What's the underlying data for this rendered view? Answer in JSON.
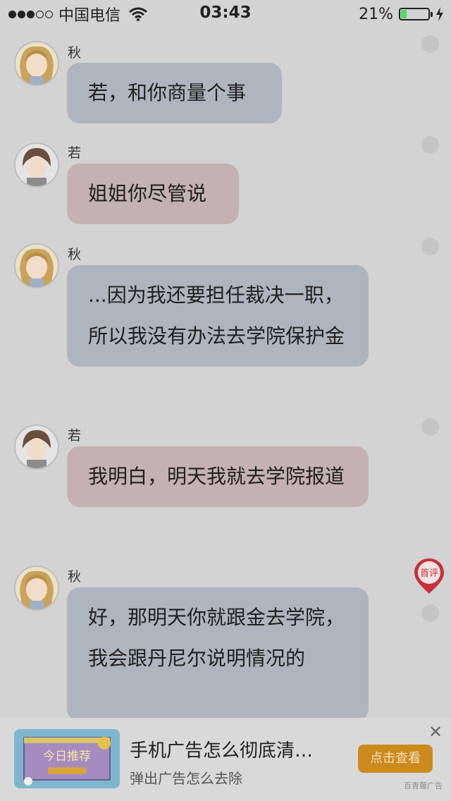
{
  "status_bar": {
    "carrier": "中国电信",
    "time": "03:43",
    "battery_percent": "21%",
    "battery_level": 0.21,
    "signal_bars_filled": 3,
    "signal_bars_total": 5
  },
  "messages": [
    {
      "sender": "秋",
      "text": "若，和你商量个事",
      "side": "qiu"
    },
    {
      "sender": "若",
      "text": "姐姐你尽管说",
      "side": "ruo"
    },
    {
      "sender": "秋",
      "text": "...因为我还要担任裁决一职，所以我没有办法去学院保护金",
      "side": "qiu"
    },
    {
      "sender": "若",
      "text": "我明白，明天我就去学院报道",
      "side": "ruo"
    },
    {
      "sender": "秋",
      "text": "好，那明天你就跟金去学院，我会跟丹尼尔说明情况的",
      "side": "qiu"
    }
  ],
  "pin_label": "首评",
  "ad": {
    "title": "手机广告怎么彻底清…",
    "subtitle": "弹出广告怎么去除",
    "button": "点击查看",
    "close": "✕",
    "source": "百青藤广告",
    "thumb_text": "今日推荐"
  },
  "colors": {
    "overlay_background": "#d3d3d3",
    "bubble_qiu": "#aeb5bf",
    "bubble_ruo": "#c4b1b1",
    "ad_button": "#cc8a1d",
    "pin": "#c8303a"
  }
}
